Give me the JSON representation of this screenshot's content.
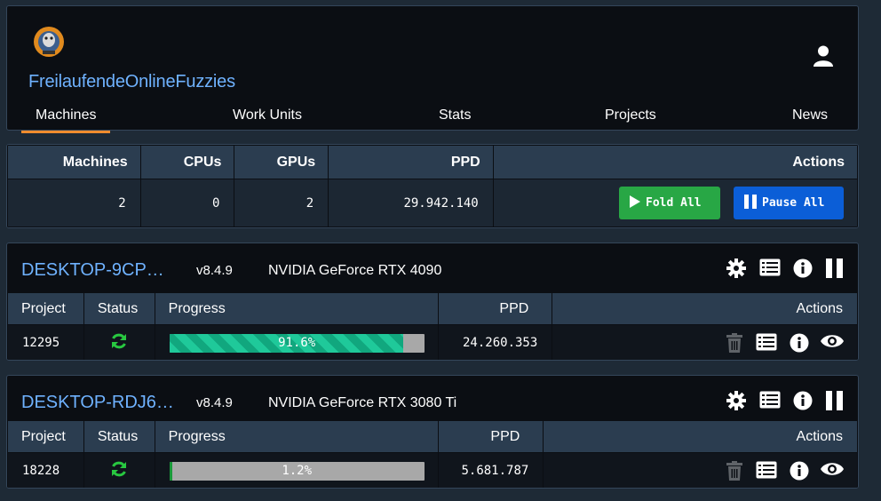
{
  "header": {
    "team_name": "FreilaufendeOnlineFuzzies",
    "nav": [
      {
        "label": "Machines",
        "active": true
      },
      {
        "label": "Work Units",
        "active": false
      },
      {
        "label": "Stats",
        "active": false
      },
      {
        "label": "Projects",
        "active": false
      },
      {
        "label": "News",
        "active": false
      }
    ]
  },
  "summary": {
    "headers": [
      "Machines",
      "CPUs",
      "GPUs",
      "PPD",
      "Actions"
    ],
    "values": {
      "machines": "2",
      "cpus": "0",
      "gpus": "2",
      "ppd": "29.942.140"
    },
    "fold_all_label": "Fold All",
    "pause_all_label": "Pause All"
  },
  "machines": [
    {
      "name": "DESKTOP-9CP…",
      "version": "v8.4.9",
      "gpu": "NVIDIA GeForce RTX 4090",
      "headers": [
        "Project",
        "Status",
        "Progress",
        "PPD",
        "Actions"
      ],
      "row": {
        "project": "12295",
        "progress_label": "91.6%",
        "progress": 91.6,
        "ppd": "24.260.353"
      }
    },
    {
      "name": "DESKTOP-RDJ6…",
      "version": "v8.4.9",
      "gpu": "NVIDIA GeForce RTX 3080 Ti",
      "headers": [
        "Project",
        "Status",
        "Progress",
        "PPD",
        "Actions"
      ],
      "row": {
        "project": "18228",
        "progress_label": "1.2%",
        "progress": 1.2,
        "ppd": "5.681.787"
      }
    }
  ],
  "colors": {
    "accent_blue": "#6fb2ff",
    "nav_active": "#f08c2e",
    "fold_green": "#28a745",
    "pause_blue": "#0b5ed7",
    "status_green": "#28c840"
  },
  "icons": {
    "logo": "team-logo",
    "user": "user-icon",
    "settings": "gear-icon",
    "log": "log-icon",
    "info": "info-icon",
    "pause": "pause-icon",
    "status": "refresh-icon",
    "delete": "trash-icon",
    "view": "eye-icon"
  }
}
